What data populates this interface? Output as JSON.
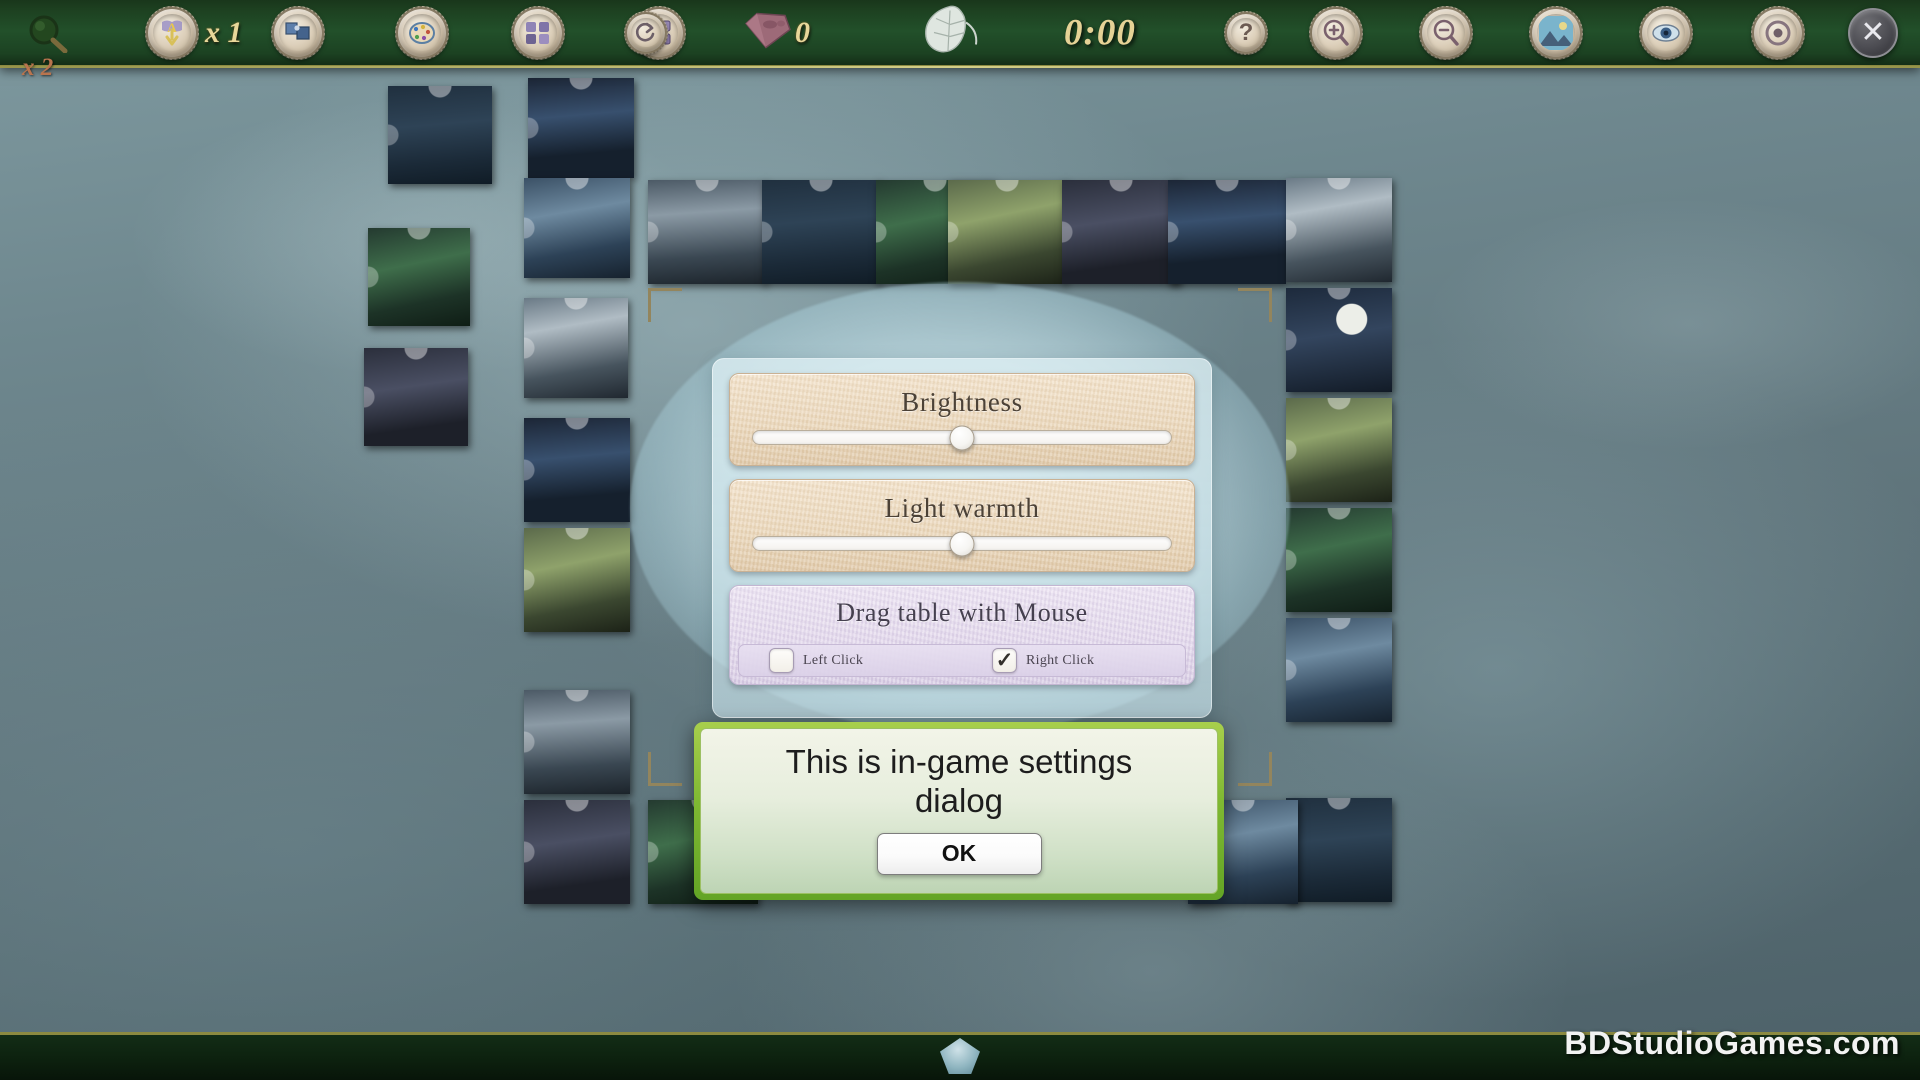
{
  "toolbar": {
    "items": [
      {
        "name": "magnifier-preview-icon",
        "label": "",
        "icon": "magnifier"
      },
      {
        "name": "hint-arrow-icon",
        "label": "",
        "icon": "arrow-hint"
      },
      {
        "name": "edge-pieces-icon",
        "label": "",
        "icon": "edge-pieces"
      },
      {
        "name": "palette-icon",
        "label": "",
        "icon": "palette"
      },
      {
        "name": "sort-pieces-icon",
        "label": "",
        "icon": "sort-pieces"
      },
      {
        "name": "group-pieces-icon",
        "label": "",
        "icon": "group-pieces"
      },
      {
        "name": "rotate-icon",
        "label": "",
        "icon": "rotate"
      }
    ],
    "hint_multiplier": "x 1",
    "table_multiplier": "x 2",
    "gem_count": "0",
    "timer": "0:00",
    "help_label": "?",
    "zoom_in_label": "+",
    "zoom_out_label": "−",
    "close_label": "✕"
  },
  "settings": {
    "brightness": {
      "title": "Brightness",
      "value_percent": 50
    },
    "light_warmth": {
      "title": "Light warmth",
      "value_percent": 50
    },
    "drag_table": {
      "title": "Drag table with Mouse",
      "options": [
        {
          "label": "Left Click",
          "checked": false,
          "check_glyph": "✓"
        },
        {
          "label": "Right Click",
          "checked": true,
          "check_glyph": "✓"
        }
      ]
    }
  },
  "message_dialog": {
    "text": "This is in-game settings dialog",
    "ok_label": "OK"
  },
  "watermark": "BDStudioGames.com",
  "colors": {
    "toolbar_green": "#22502a",
    "toolbar_gold": "#8c8a41",
    "timer_gold": "#e5d296",
    "panel_beige": "#ebd8bc",
    "panel_purple": "#e3d8ec",
    "dialog_green": "#7fb832",
    "table_blue": "#60757c"
  }
}
